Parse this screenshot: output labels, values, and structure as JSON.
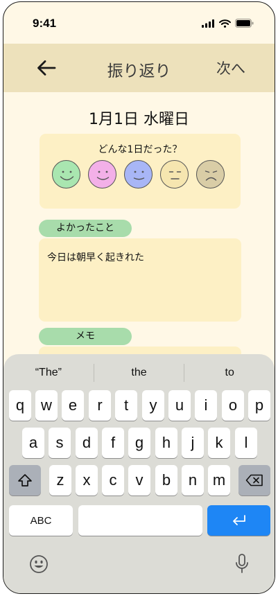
{
  "status": {
    "time": "9:41"
  },
  "nav": {
    "title": "振り返り",
    "next_label": "次へ"
  },
  "date": "1月1日 水曜日",
  "mood": {
    "question": "どんな1日だった？",
    "faces": [
      {
        "name": "very-happy",
        "color": "#a9e6b0"
      },
      {
        "name": "happy",
        "color": "#f3b0e8"
      },
      {
        "name": "content",
        "color": "#a8b6f6"
      },
      {
        "name": "neutral",
        "color": "#f6e6b0"
      },
      {
        "name": "sad",
        "color": "#d9cda6"
      }
    ]
  },
  "good_things": {
    "label": "よかったこと",
    "text": "今日は朝早く起きれた"
  },
  "memo": {
    "label": "メモ",
    "text": ""
  },
  "keyboard": {
    "suggestions": [
      "“The”",
      "the",
      "to"
    ],
    "row1": [
      "q",
      "w",
      "e",
      "r",
      "t",
      "y",
      "u",
      "i",
      "o",
      "p"
    ],
    "row2": [
      "a",
      "s",
      "d",
      "f",
      "g",
      "h",
      "j",
      "k",
      "l"
    ],
    "row3": [
      "z",
      "x",
      "c",
      "v",
      "b",
      "n",
      "m"
    ],
    "abc_label": "ABC",
    "return_color": "#1e86f5"
  }
}
